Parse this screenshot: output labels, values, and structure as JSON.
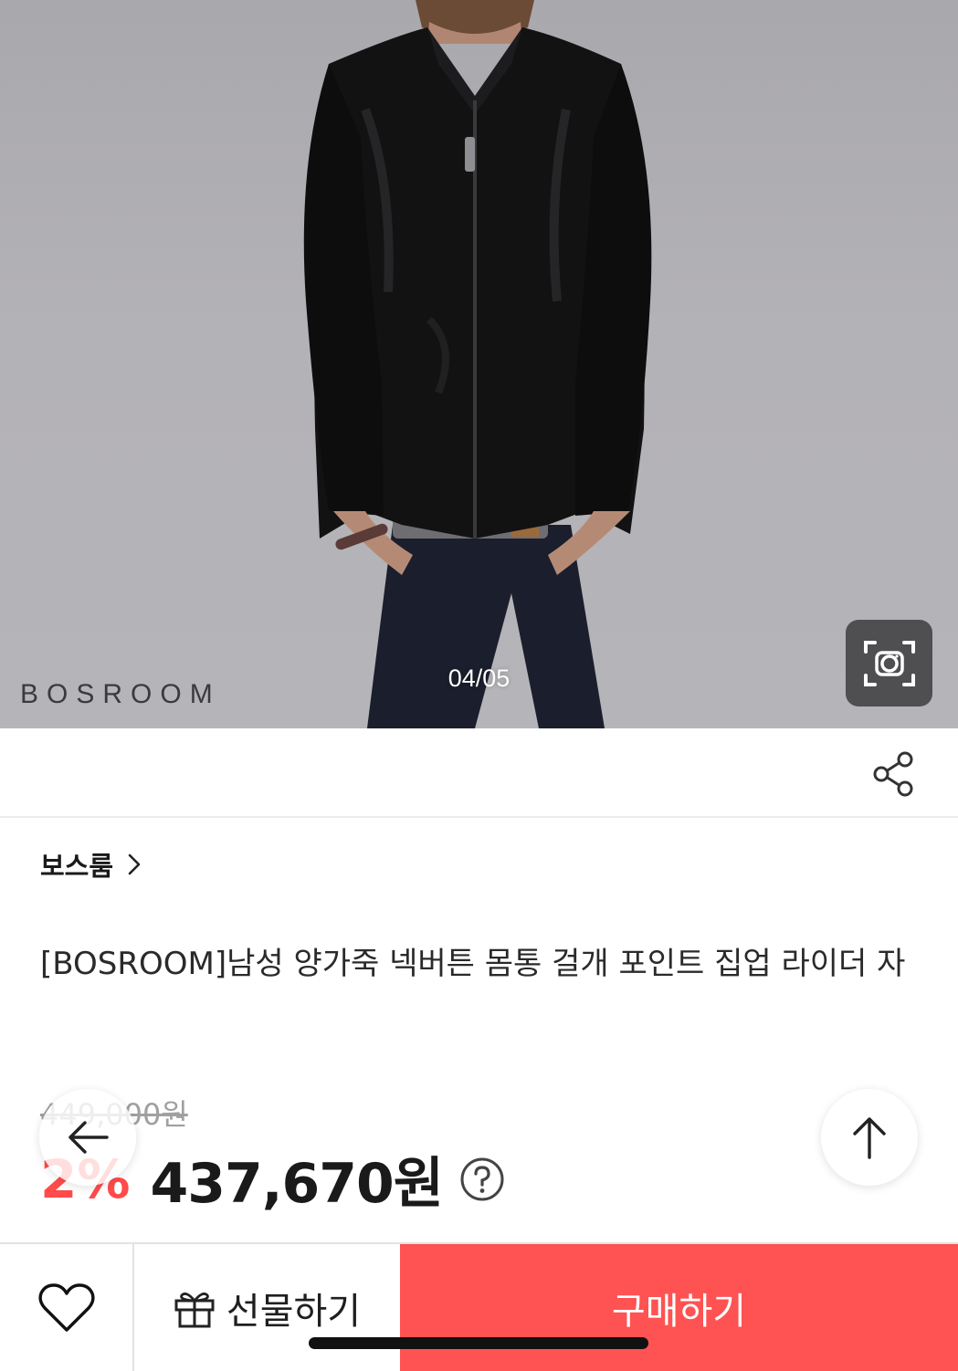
{
  "gallery": {
    "watermark": "BOSROOM",
    "page_indicator": "04/05",
    "lens_icon": "camera-lens-icon"
  },
  "share": {
    "icon": "share-icon"
  },
  "product": {
    "store_name": "보스룸",
    "title": "[BOSROOM]남성 양가죽 넥버튼 몸통 걸개 포인트 집업 라이더 자",
    "original_price": "449,000원",
    "discount": "2%",
    "sale_price": "437,670원"
  },
  "bottom_bar": {
    "gift_label": "선물하기",
    "buy_label": "구매하기"
  },
  "colors": {
    "accent": "#ff5252",
    "discount": "#ff4b4b",
    "photo_bg": "#b3b2b6"
  }
}
